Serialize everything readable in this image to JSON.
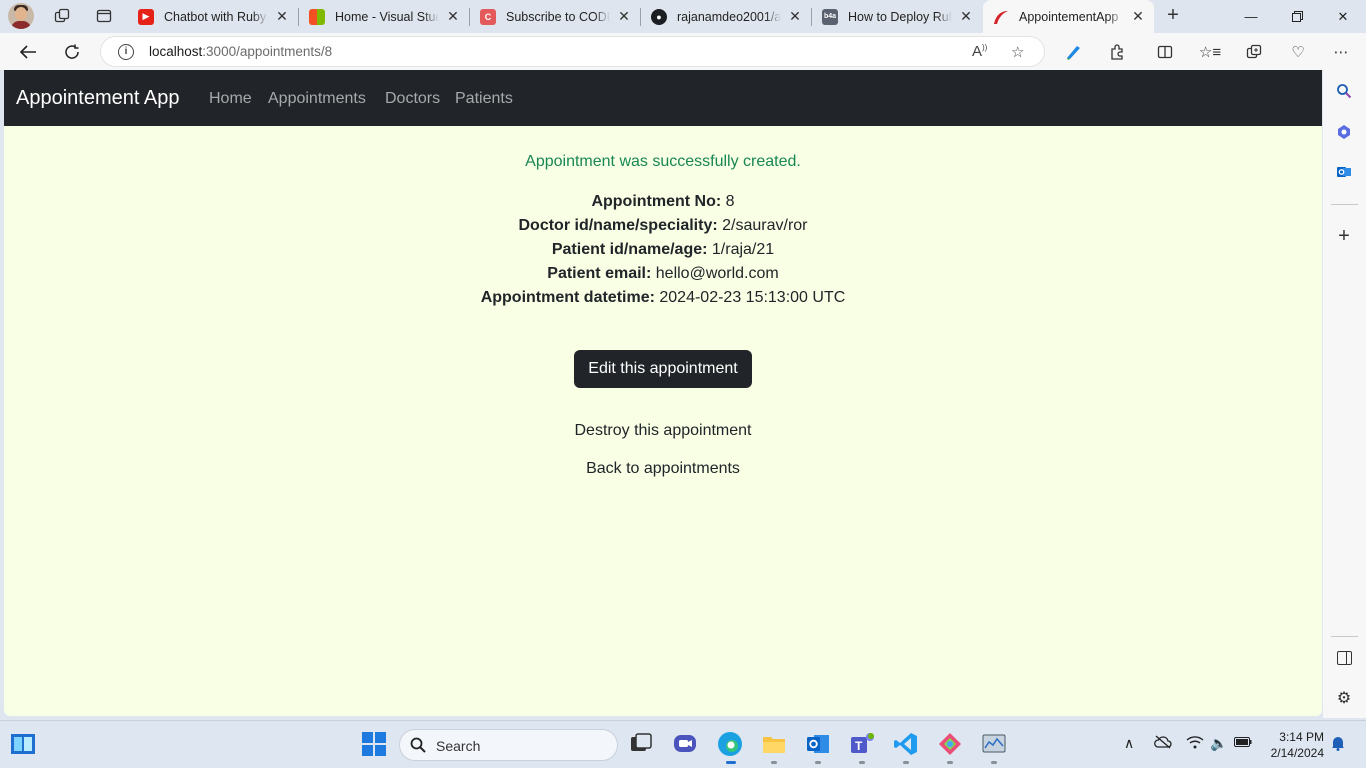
{
  "browser": {
    "tabs": [
      {
        "title": "Chatbot with Ruby o",
        "favicon_color": "#e62117",
        "active": false
      },
      {
        "title": "Home - Visual Studi",
        "favicon_color": "#f25022",
        "active": false
      },
      {
        "title": "Subscribe to CODE I",
        "favicon_color": "#e45a5a",
        "active": false
      },
      {
        "title": "rajanamdeo2001/ap",
        "favicon_color": "#1b1f23",
        "active": false
      },
      {
        "title": "How to Deploy Ruby",
        "favicon_color": "#5a6270",
        "active": false
      },
      {
        "title": "AppointementApp",
        "favicon_color": "#d4232b",
        "active": true
      }
    ],
    "address": {
      "host": "localhost",
      "path": ":3000/appointments/8"
    }
  },
  "page": {
    "brand": "Appointement App",
    "nav": [
      "Home",
      "Appointments",
      "Doctors",
      "Patients"
    ],
    "notice": "Appointment was successfully created.",
    "details": [
      {
        "label": "Appointment No:",
        "value": "8"
      },
      {
        "label": "Doctor id/name/speciality:",
        "value": "2/saurav/ror"
      },
      {
        "label": "Patient id/name/age:",
        "value": "1/raja/21"
      },
      {
        "label": "Patient email:",
        "value": "hello@world.com"
      },
      {
        "label": "Appointment datetime:",
        "value": "2024-02-23 15:13:00 UTC"
      }
    ],
    "edit_label": "Edit this appointment",
    "destroy_label": "Destroy this appointment",
    "back_label": "Back to appointments",
    "background_color": "#f8ffe5",
    "navbar_color": "#212529",
    "notice_color": "#198754"
  },
  "taskbar": {
    "search_label": "Search",
    "time": "3:14 PM",
    "date": "2/14/2024"
  }
}
